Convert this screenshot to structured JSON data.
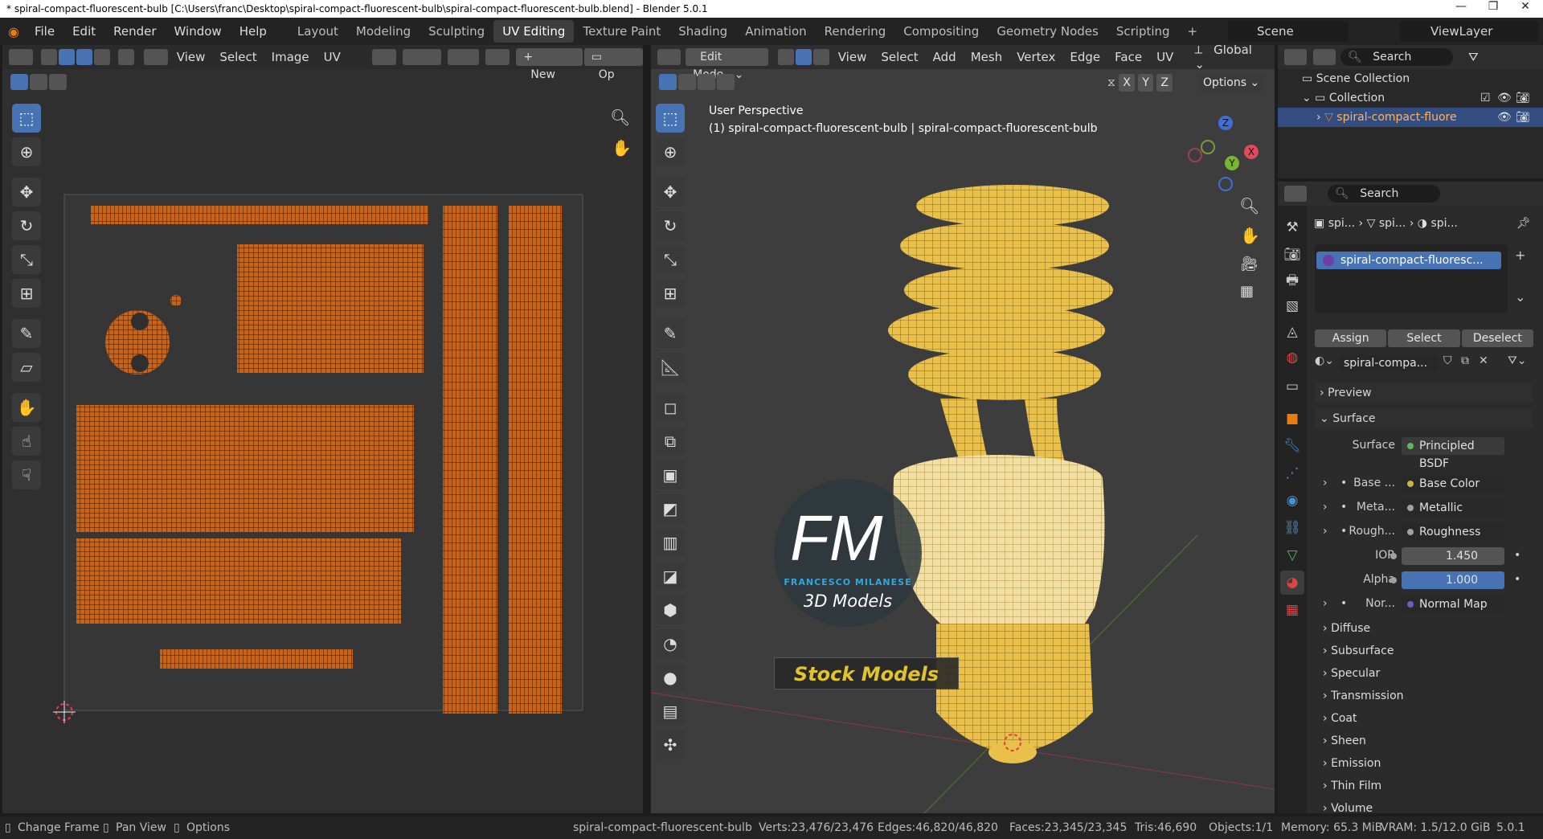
{
  "window": {
    "title": "* spiral-compact-fluorescent-bulb [C:\\Users\\franc\\Desktop\\spiral-compact-fluorescent-bulb\\spiral-compact-fluorescent-bulb.blend] - Blender 5.0.1",
    "minimize": "—",
    "maximize": "❐",
    "close": "✕"
  },
  "menu": [
    "File",
    "Edit",
    "Render",
    "Window",
    "Help"
  ],
  "workspaces": [
    "Layout",
    "Modeling",
    "Sculpting",
    "UV Editing",
    "Texture Paint",
    "Shading",
    "Animation",
    "Rendering",
    "Compositing",
    "Geometry Nodes",
    "Scripting"
  ],
  "active_workspace": "UV Editing",
  "add_workspace": "+",
  "scene": {
    "label": "Scene",
    "viewlayer": "ViewLayer"
  },
  "uv_editor": {
    "menus": [
      "View",
      "Select",
      "Image",
      "UV"
    ],
    "new_label": "New",
    "open_label": "Op"
  },
  "viewport": {
    "mode": "Edit Mode",
    "menus": [
      "View",
      "Select",
      "Add",
      "Mesh",
      "Vertex",
      "Edge",
      "Face",
      "UV"
    ],
    "orientation": "Global",
    "options": "Options",
    "axes": [
      "X",
      "Y",
      "Z"
    ],
    "overlay_line1": "User Perspective",
    "overlay_line2": "(1) spiral-compact-fluorescent-bulb | spiral-compact-fluorescent-bulb"
  },
  "gizmo": {
    "z": "Z",
    "y": "Y",
    "x": "X"
  },
  "watermark": {
    "logo": "FM",
    "name": "FRANCESCO MILANESE",
    "sub": "3D Models",
    "banner": "Stock Models"
  },
  "outliner": {
    "search_placeholder": "Search",
    "scene_collection": "Scene Collection",
    "collection": "Collection",
    "object": "spiral-compact-fluore"
  },
  "properties": {
    "search_placeholder": "Search",
    "breadcrumb": [
      "spi...",
      "spi...",
      "spi..."
    ],
    "material_slot": "spiral-compact-fluoresc...",
    "assign": "Assign",
    "select": "Select",
    "deselect": "Deselect",
    "material_name": "spiral-compa...",
    "preview": "Preview",
    "surface_panel": "Surface",
    "surface_label": "Surface",
    "surface_value": "Principled BSDF",
    "inputs": [
      {
        "label": "Base ...",
        "value": "Base Color",
        "color": "#c7b53d",
        "expand": true
      },
      {
        "label": "Meta...",
        "value": "Metallic",
        "color": "#a1a1a1",
        "expand": true
      },
      {
        "label": "Rough...",
        "value": "Roughness",
        "color": "#a1a1a1",
        "expand": true
      },
      {
        "label": "IOR",
        "value": "1.450",
        "color": "#a1a1a1",
        "expand": false
      },
      {
        "label": "Alpha",
        "value": "1.000",
        "color": "#a1a1a1",
        "expand": false
      },
      {
        "label": "Nor...",
        "value": "Normal Map",
        "color": "#6363c7",
        "expand": true
      }
    ],
    "subpanels": [
      "Diffuse",
      "Subsurface",
      "Specular",
      "Transmission",
      "Coat",
      "Sheen",
      "Emission",
      "Thin Film",
      "Volume"
    ]
  },
  "status": {
    "change_frame": "Change Frame",
    "pan_view": "Pan View",
    "options": "Options",
    "object": "spiral-compact-fluorescent-bulb",
    "verts": "Verts:23,476/23,476",
    "edges": "Edges:46,820/46,820",
    "faces": "Faces:23,345/23,345",
    "tris": "Tris:46,690",
    "objects": "Objects:1/1",
    "memory": "Memory: 65.3 MiB",
    "vram": "VRAM: 1.5/12.0 GiB",
    "version": "5.0.1"
  }
}
